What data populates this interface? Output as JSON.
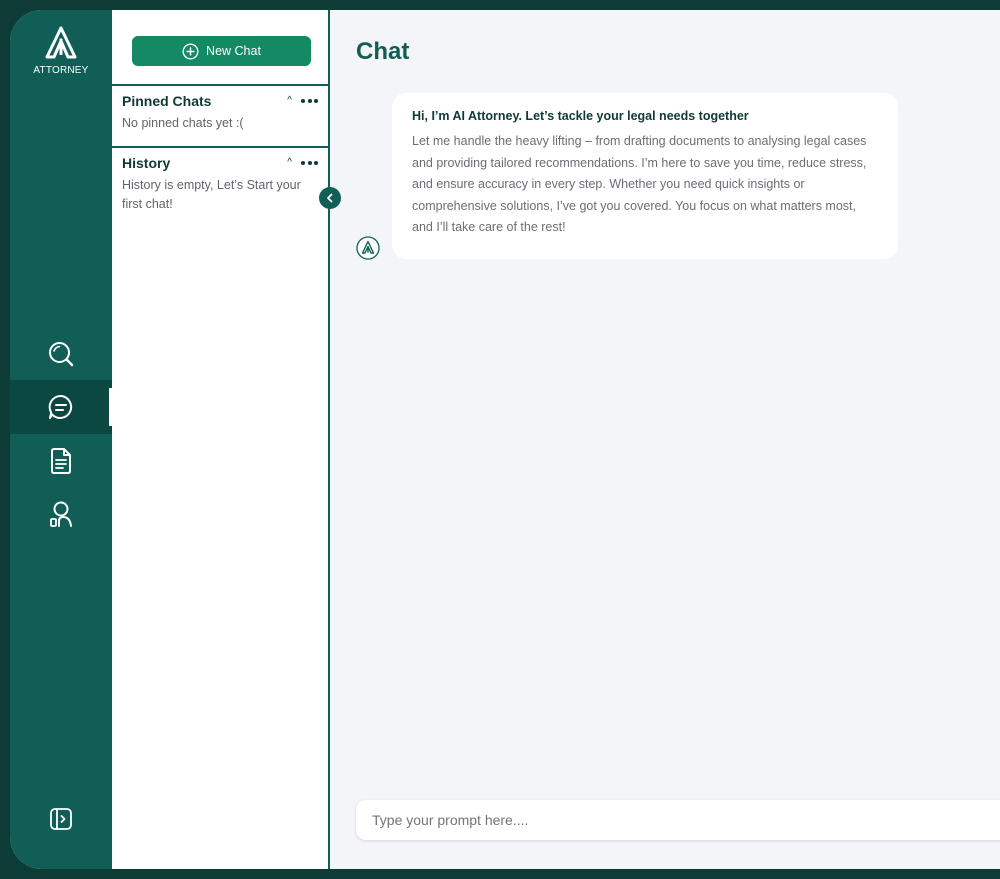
{
  "brand": {
    "logo_text": "ATTORNEY",
    "primary_color": "#105e56",
    "accent_color": "#138a63"
  },
  "rail": {
    "items": [
      {
        "icon": "search-icon",
        "active": false
      },
      {
        "icon": "chat-icon",
        "active": true
      },
      {
        "icon": "document-icon",
        "active": false
      },
      {
        "icon": "user-icon",
        "active": false
      }
    ],
    "bottom_icon": "expand-sidebar-icon"
  },
  "panel": {
    "new_chat_label": "New Chat",
    "pinned": {
      "title": "Pinned Chats",
      "empty_text": "No pinned chats yet :("
    },
    "history": {
      "title": "History",
      "empty_text": "History is empty, Let’s Start your first chat!"
    }
  },
  "main": {
    "title": "Chat",
    "message": {
      "title": "Hi, I’m AI Attorney. Let’s tackle your legal needs together",
      "body": "Let me handle the heavy lifting – from drafting documents to analysing legal cases and providing tailored recommendations. I’m here to save you time, reduce stress, and ensure accuracy in every step. Whether you need quick insights or comprehensive solutions, I’ve got you covered. You focus on what matters most, and I’ll take care of the rest!"
    },
    "prompt": {
      "placeholder": "Type your prompt here....",
      "value": ""
    }
  }
}
